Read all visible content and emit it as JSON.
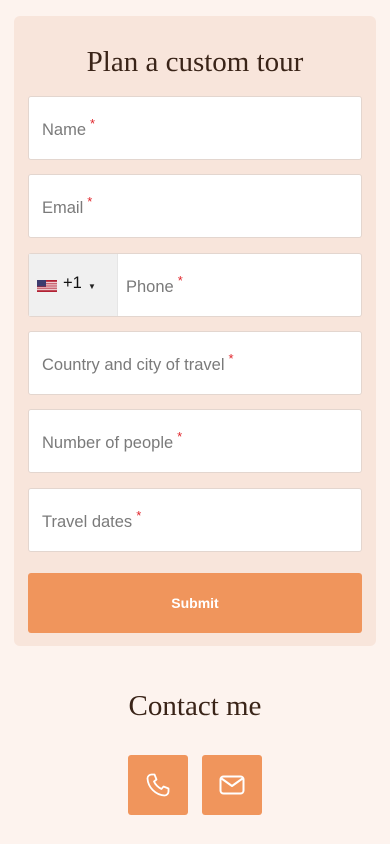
{
  "form": {
    "title": "Plan a custom tour",
    "fields": [
      {
        "placeholder": "Name",
        "required": "*"
      },
      {
        "placeholder": "Email",
        "required": "*"
      },
      {
        "placeholder": "Phone",
        "required": "*",
        "country_code": "+1",
        "flag_icon": "us-flag-icon"
      },
      {
        "placeholder": "Country and city of travel",
        "required": "*"
      },
      {
        "placeholder": "Number of people",
        "required": "*"
      },
      {
        "placeholder": "Travel dates",
        "required": "*"
      }
    ],
    "submit_label": "Submit"
  },
  "contact": {
    "title": "Contact me",
    "buttons": [
      {
        "icon": "phone-icon"
      },
      {
        "icon": "mail-icon"
      }
    ]
  },
  "colors": {
    "page_bg": "#fdf3ee",
    "card_bg": "#f8e5db",
    "accent": "#f0955c",
    "required": "#e0242a",
    "title": "#3a2418"
  }
}
